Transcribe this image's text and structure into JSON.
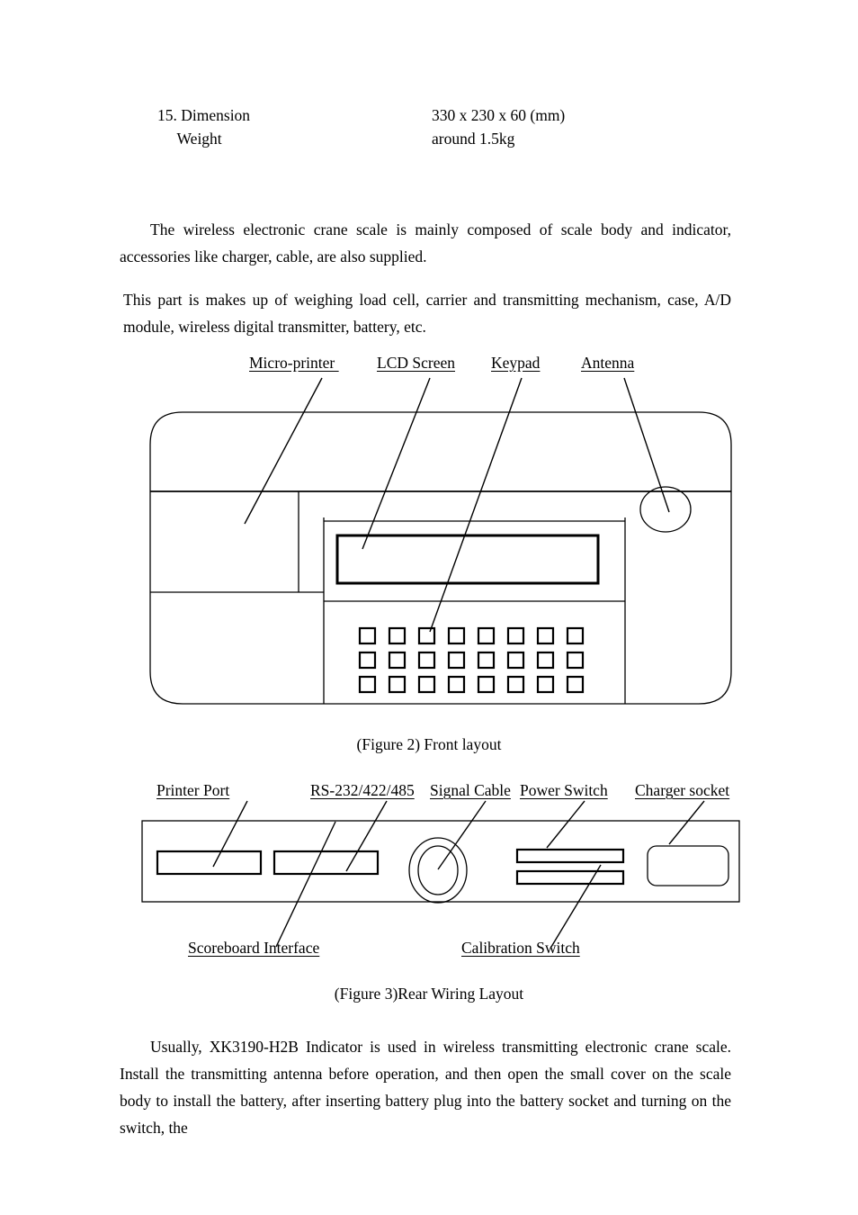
{
  "document": {
    "spec_table": [
      {
        "label": "15. Dimension",
        "value": "330 x 230 x 60 (mm)"
      },
      {
        "label": "     Weight",
        "value": "around 1.5kg"
      }
    ],
    "paragraphs": {
      "intro": "The wireless electronic crane scale is mainly composed of scale body and indicator, accessories like charger, cable, are also supplied.",
      "composition": "This part is makes up of weighing load cell, carrier and transmitting mechanism, case, A/D module, wireless digital transmitter, battery, etc.",
      "usage": "Usually, XK3190-H2B Indicator is used in wireless transmitting electronic crane scale. Install the transmitting antenna before operation, and then open the small cover on the scale body to install the battery, after inserting battery plug into the battery socket and turning on the switch, the"
    }
  },
  "figure2": {
    "caption": "(Figure 2) Front layout",
    "labels": {
      "micro_printer": "Micro-printer ",
      "lcd_screen": "LCD Screen",
      "keypad": "Keypad",
      "antenna": "Antenna"
    },
    "keypad": {
      "rows": 3,
      "columns": 8
    }
  },
  "figure3": {
    "caption": "(Figure 3)Rear Wiring Layout",
    "labels": {
      "printer_port": "Printer Port",
      "rs232": "RS-232/422/485",
      "signal_cable": "Signal Cable",
      "power_switch": "Power Switch",
      "charger_socket": "Charger socket",
      "scoreboard_interface": "Scoreboard Interface",
      "calibration_switch": "Calibration Switch"
    }
  },
  "colors": {
    "ink": "#000000",
    "paper": "#ffffff"
  }
}
